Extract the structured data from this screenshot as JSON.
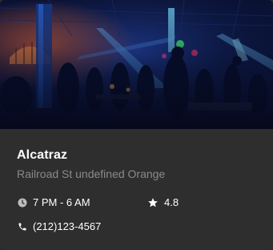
{
  "venue": {
    "name": "Alcatraz",
    "address": "Railroad St undefined Orange",
    "hours": "7 PM - 6 AM",
    "rating": "4.8",
    "phone": "(212)123-4567"
  },
  "icons": {
    "hours": "clock-icon",
    "rating": "star-icon",
    "phone": "phone-icon"
  },
  "colors": {
    "card_background": "#2e2e2e",
    "title": "#ffffff",
    "subtitle": "#8a8a8a"
  }
}
